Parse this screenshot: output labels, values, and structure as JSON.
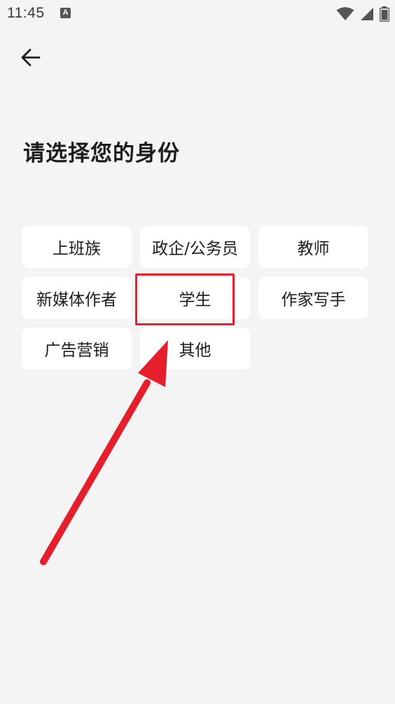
{
  "status_bar": {
    "time": "11:45",
    "notification_letter": "A"
  },
  "header": {
    "title": "请选择您的身份"
  },
  "options": [
    {
      "label": "上班族"
    },
    {
      "label": "政企/公务员"
    },
    {
      "label": "教师"
    },
    {
      "label": "新媒体作者"
    },
    {
      "label": "学生"
    },
    {
      "label": "作家写手"
    },
    {
      "label": "广告营销"
    },
    {
      "label": "其他"
    }
  ],
  "annotation": {
    "color": "#e5202c",
    "highlighted_option": "学生"
  }
}
